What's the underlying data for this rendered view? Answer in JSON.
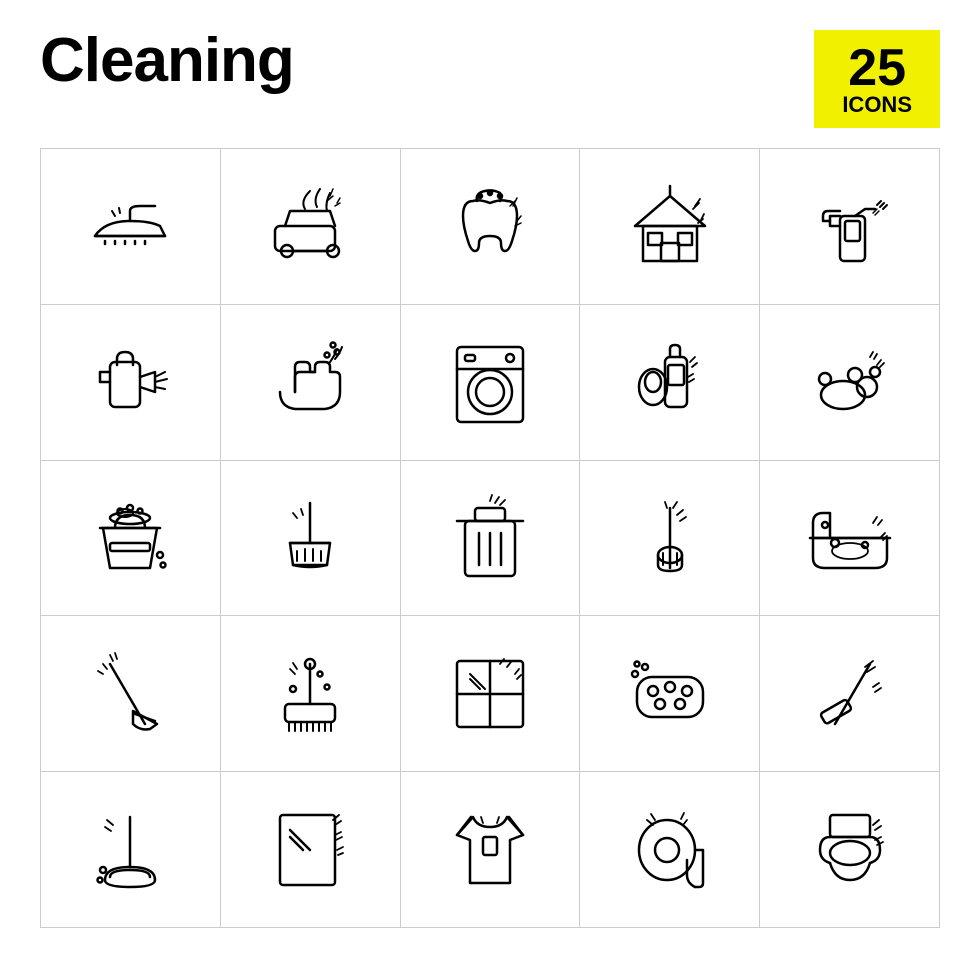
{
  "header": {
    "title": "Cleaning",
    "badge_number": "25",
    "badge_text": "ICONS"
  },
  "icons": [
    "iron",
    "car-wash",
    "tooth",
    "clean-house",
    "spray-bottle",
    "spray-gun",
    "hand-wash",
    "washing-machine",
    "cleaner-bottle",
    "soap-bubbles",
    "bucket",
    "dustpan",
    "trash-bin",
    "toilet-brush",
    "bathtub",
    "broom",
    "floor-brush",
    "window",
    "sponge",
    "squeegee",
    "plunger",
    "glass-clean",
    "shirt",
    "toilet-paper",
    "toilet"
  ]
}
